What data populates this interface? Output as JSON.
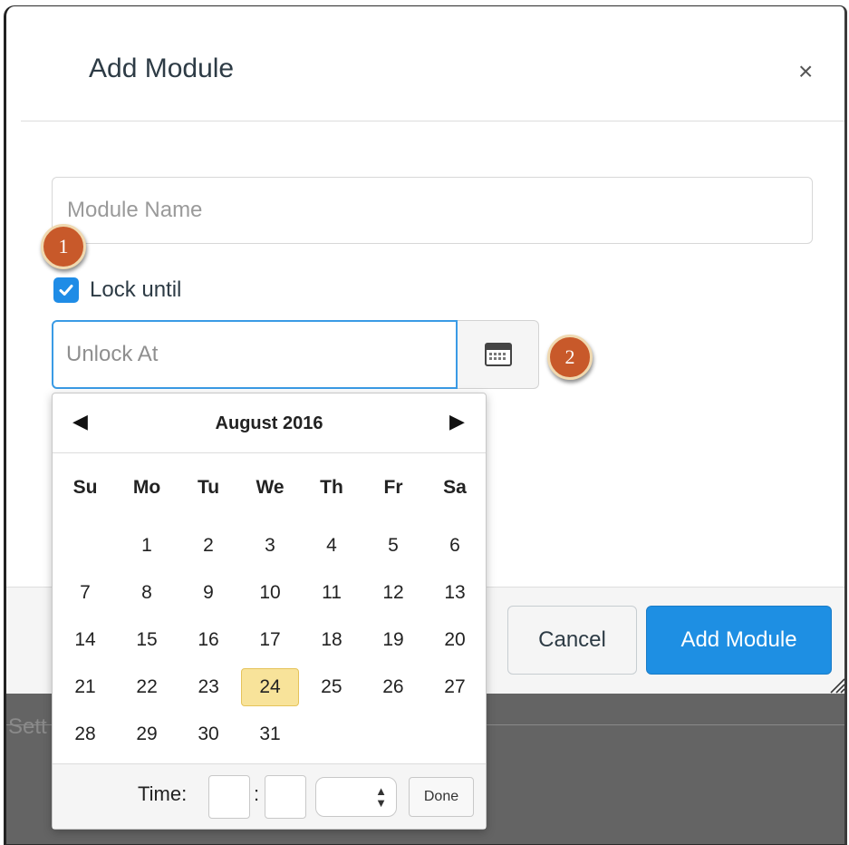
{
  "dialog": {
    "title": "Add Module",
    "close_symbol": "×"
  },
  "form": {
    "module_name_placeholder": "Module Name",
    "module_name_value": "",
    "lock_checked": true,
    "lock_label": "Lock until",
    "unlock_placeholder": "Unlock At",
    "unlock_value": ""
  },
  "annotations": {
    "badge1": "1",
    "badge2": "2"
  },
  "datepicker": {
    "month_label": "August 2016",
    "prev_symbol": "◀",
    "next_symbol": "▶",
    "weekdays": [
      "Su",
      "Mo",
      "Tu",
      "We",
      "Th",
      "Fr",
      "Sa"
    ],
    "weeks": [
      [
        "",
        "1",
        "2",
        "3",
        "4",
        "5",
        "6"
      ],
      [
        "7",
        "8",
        "9",
        "10",
        "11",
        "12",
        "13"
      ],
      [
        "14",
        "15",
        "16",
        "17",
        "18",
        "19",
        "20"
      ],
      [
        "21",
        "22",
        "23",
        "24",
        "25",
        "26",
        "27"
      ],
      [
        "28",
        "29",
        "30",
        "31",
        "",
        "",
        ""
      ]
    ],
    "today": "24",
    "time_label": "Time:",
    "time_colon": ":",
    "hour_value": "",
    "minute_value": "",
    "ampm_value": "",
    "done_label": "Done"
  },
  "footer": {
    "cancel_label": "Cancel",
    "add_label": "Add Module",
    "background_text": "Sett"
  },
  "colors": {
    "primary": "#1e8fe3",
    "badge": "#c8592a",
    "today_highlight": "#f8e39a",
    "focus_border": "#3a9be5"
  },
  "icons": {
    "checkbox": "checkmark-icon",
    "calendar": "calendar-icon",
    "resize": "resize-handle-icon",
    "close": "close-icon"
  }
}
